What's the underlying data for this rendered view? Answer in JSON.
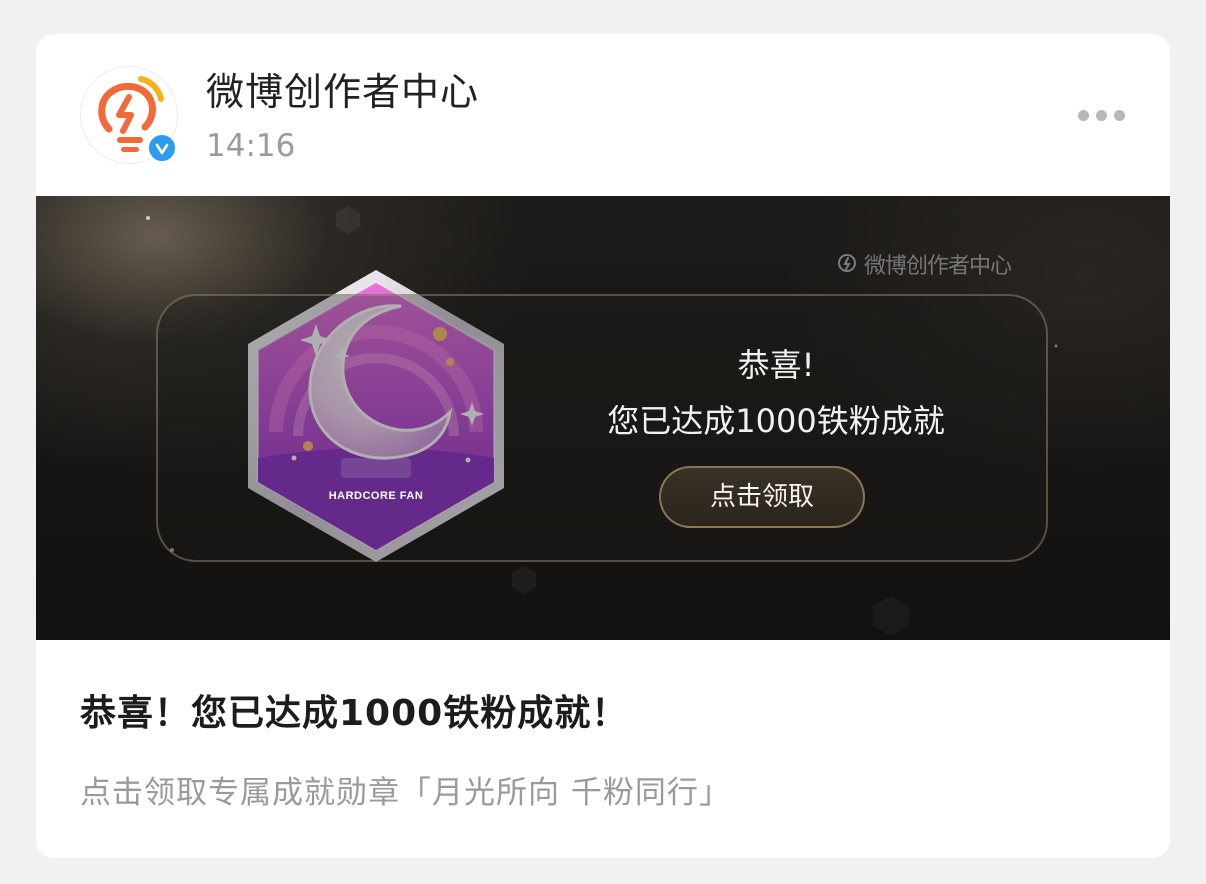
{
  "post": {
    "author": "微博创作者中心",
    "time": "14:16",
    "title": "恭喜！您已达成1000铁粉成就！",
    "subtitle": "点击领取专属成就勋章「月光所向 千粉同行」"
  },
  "banner": {
    "watermark": "微博创作者中心",
    "congrats": "恭喜!",
    "achievement": "您已达成1000铁粉成就",
    "claim_button": "点击领取",
    "badge_label": "HARDCORE FAN"
  },
  "icons": {
    "avatar": "lightbulb-lightning-logo",
    "verified": "verified-check-icon",
    "more": "more-dots-icon",
    "badge": "moon-badge-icon"
  },
  "colors": {
    "avatar_orange": "#f26a3a",
    "avatar_yellow": "#f6b21c",
    "verified_blue": "#2c9bf0",
    "badge_purple": "#b13fd6",
    "badge_pink": "#e063c8"
  }
}
